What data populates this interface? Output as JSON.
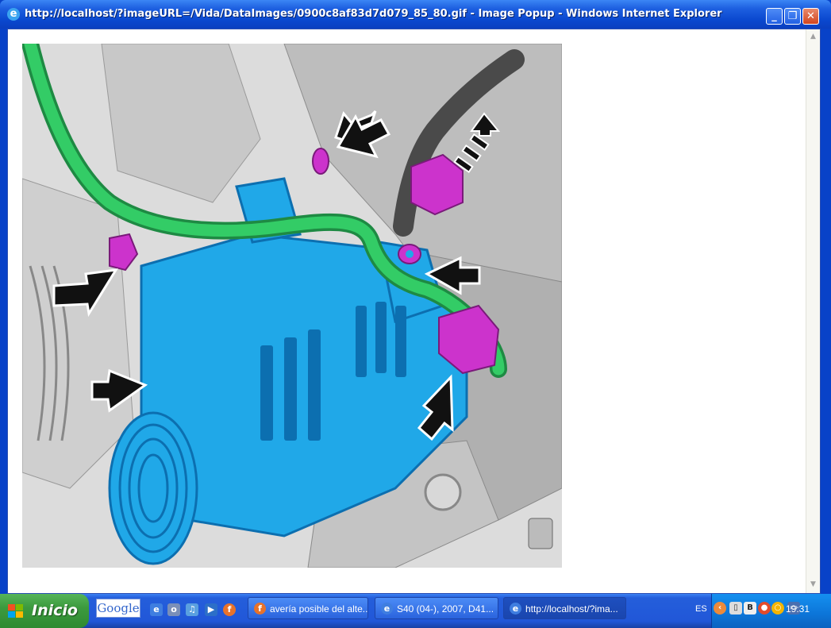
{
  "window": {
    "title": "http://localhost/?imageURL=/Vida/DataImages/0900c8af83d7d079_85_80.gif - Image Popup - Windows Internet Explorer",
    "title_icon": "ie-icon",
    "controls": {
      "minimize": "_",
      "maximize": "❐",
      "close": "✕"
    }
  },
  "image": {
    "description_icon": "alternator-diagram",
    "colors": {
      "alternator": "#20a8e8",
      "hose": "#33cc66",
      "fasteners": "#cc33cc",
      "arrows": "#111111"
    }
  },
  "taskbar": {
    "start_label": "Inicio",
    "google_label": "Google",
    "quick_launch": [
      "ie-icon",
      "outlook-icon",
      "media-icon",
      "player-icon",
      "firefox-icon"
    ],
    "tasks": [
      {
        "icon": "firefox-icon",
        "label": "avería posible del alte..."
      },
      {
        "icon": "ie-icon",
        "label": "S40 (04-), 2007, D41..."
      },
      {
        "icon": "ie-icon",
        "label": "http://localhost/?ima..."
      }
    ],
    "tray": {
      "language": "ES",
      "icons": [
        "collapse-chevron-icon",
        "device-icon",
        "network-icon",
        "antivirus-icon",
        "sync-icon",
        "monitor-icon"
      ],
      "clock": "19:31"
    }
  }
}
